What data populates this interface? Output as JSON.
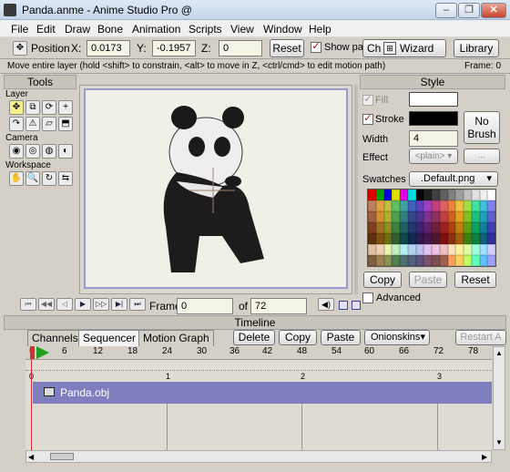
{
  "window": {
    "title": "Panda.anme - Anime Studio Pro @",
    "buttons": [
      "–",
      "❐",
      "✕"
    ]
  },
  "menu": [
    "File",
    "Edit",
    "Draw",
    "Bone",
    "Animation",
    "Scripts",
    "View",
    "Window",
    "Help"
  ],
  "toolopts": {
    "position_label": "Position",
    "x_label": "X:",
    "x_value": "0.0173",
    "y_label": "Y:",
    "y_value": "-0.1957",
    "z_label": "Z:",
    "z_value": "0",
    "reset": "Reset",
    "show_paths": "Show paths",
    "character_wizard_a": "Ch",
    "character_wizard_b": "Wizard",
    "library": "Library"
  },
  "status": {
    "message": "Move entire layer (hold <shift> to constrain, <alt> to move in Z, <ctrl/cmd> to edit motion path)",
    "frame": "Frame: 0"
  },
  "tools": {
    "title": "Tools",
    "sections": {
      "layer": "Layer",
      "camera": "Camera",
      "workspace": "Workspace"
    }
  },
  "playback": {
    "frame_label": "Frame",
    "frame_value": "0",
    "of_label": "of",
    "total_frames": "72"
  },
  "style": {
    "title": "Style",
    "fill": "Fill",
    "stroke": "Stroke",
    "width_label": "Width",
    "width_value": "4",
    "effect_label": "Effect",
    "effect_value": "<plain>",
    "no_brush": "No Brush",
    "ellipsis": "...",
    "swatches_label": "Swatches",
    "swatches_value": ".Default.png",
    "copy": "Copy",
    "paste": "Paste",
    "reset": "Reset",
    "advanced": "Advanced"
  },
  "timeline": {
    "title": "Timeline",
    "tabs": [
      "Channels",
      "Sequencer",
      "Motion Graph"
    ],
    "buttons": {
      "delete": "Delete",
      "copy": "Copy",
      "paste": "Paste",
      "onionskins": "Onionskins",
      "restart": "Restart A"
    },
    "ruler_ticks": [
      "0",
      "6",
      "12",
      "18",
      "24",
      "30",
      "36",
      "42",
      "48",
      "54",
      "60",
      "66",
      "72",
      "78"
    ],
    "seconds": [
      "0",
      "1",
      "2",
      "3"
    ],
    "track": "Panda.obj"
  },
  "colors": {
    "accent": "#7777bb",
    "track": "#7f7fbf",
    "playhead": "#d03030"
  },
  "swatch_colors": [
    "#e00000",
    "#00a000",
    "#0000e0",
    "#e0e000",
    "#e000e0",
    "#00e0e0",
    "#000000",
    "#202020",
    "#404040",
    "#606060",
    "#808080",
    "#a0a0a0",
    "#c0c0c0",
    "#e0e0e0",
    "#f0f0f0",
    "#ffffff",
    "#c08060",
    "#e0a040",
    "#c0c040",
    "#60c060",
    "#40a0a0",
    "#4060c0",
    "#6040c0",
    "#a040c0",
    "#c04080",
    "#e06060",
    "#f08040",
    "#f0c040",
    "#a0e040",
    "#40e0a0",
    "#40c0e0",
    "#8080f0",
    "#a06040",
    "#d09030",
    "#b0b030",
    "#50a050",
    "#308080",
    "#304890",
    "#503090",
    "#803090",
    "#903060",
    "#c04040",
    "#d06020",
    "#e0a020",
    "#80c020",
    "#20c080",
    "#20a0c0",
    "#6060d0",
    "#804020",
    "#a07020",
    "#909020",
    "#408040",
    "#206060",
    "#203870",
    "#402070",
    "#602070",
    "#702040",
    "#a02020",
    "#b04010",
    "#c08010",
    "#60a010",
    "#10a060",
    "#1080a0",
    "#4040b0",
    "#603010",
    "#805010",
    "#707010",
    "#306030",
    "#104848",
    "#102850",
    "#301850",
    "#481850",
    "#501830",
    "#801010",
    "#903010",
    "#a06010",
    "#408010",
    "#108040",
    "#106080",
    "#3030a0",
    "#e0c0a0",
    "#f0d0b0",
    "#f0f0b0",
    "#c0f0c0",
    "#b0f0f0",
    "#b0d0f0",
    "#c0c0f0",
    "#e0c0f0",
    "#f0c0e0",
    "#f0c0c0",
    "#ffe0c0",
    "#fff0a0",
    "#e0ffa0",
    "#a0ffe0",
    "#a0e0ff",
    "#d0d0ff",
    "#806040",
    "#a08050",
    "#909050",
    "#508050",
    "#507070",
    "#506080",
    "#605080",
    "#805070",
    "#805050",
    "#a06050",
    "#ffa060",
    "#ffd060",
    "#c0ff60",
    "#60ffc0",
    "#60c0ff",
    "#a0a0ff"
  ]
}
